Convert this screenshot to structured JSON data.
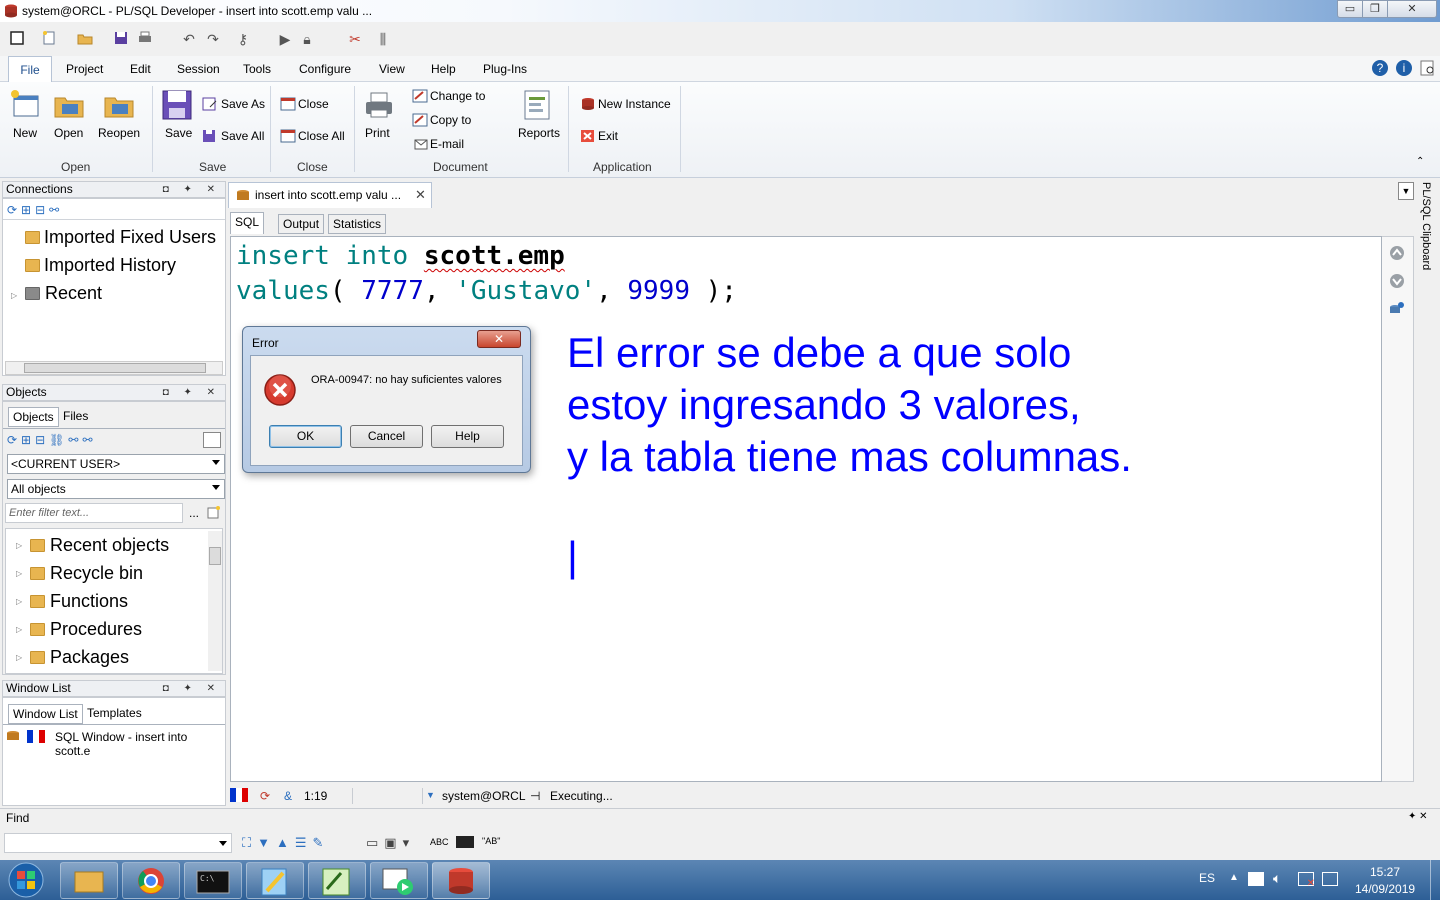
{
  "window": {
    "title": "system@ORCL - PL/SQL Developer - insert into scott.emp valu ...",
    "min_glyph": "▭",
    "max_glyph": "❐",
    "close_glyph": "✕"
  },
  "menu": {
    "tabs": [
      "File",
      "Project",
      "Edit",
      "Session",
      "Tools",
      "Configure",
      "View",
      "Help",
      "Plug-Ins"
    ]
  },
  "ribbon": {
    "open_group": {
      "label": "Open",
      "new": "New",
      "open": "Open",
      "reopen": "Reopen"
    },
    "save_group": {
      "label": "Save",
      "save": "Save",
      "save_as": "Save As",
      "save_all": "Save All"
    },
    "close_group": {
      "label": "Close",
      "close": "Close",
      "close_all": "Close All"
    },
    "document_group": {
      "label": "Document",
      "print": "Print",
      "change_to": "Change to",
      "copy_to": "Copy to",
      "email": "E-mail",
      "reports": "Reports"
    },
    "application_group": {
      "label": "Application",
      "new_instance": "New Instance",
      "exit": "Exit"
    }
  },
  "connections": {
    "title": "Connections",
    "items": [
      "Imported Fixed Users",
      "Imported History",
      "Recent"
    ]
  },
  "objects": {
    "title": "Objects",
    "tabs": [
      "Objects",
      "Files"
    ],
    "user_combo": "<CURRENT USER>",
    "filter_combo": "All objects",
    "filter_placeholder": "Enter filter text...",
    "items": [
      "Recent objects",
      "Recycle bin",
      "Functions",
      "Procedures",
      "Packages"
    ]
  },
  "window_list": {
    "title": "Window List",
    "tabs": [
      "Window List",
      "Templates"
    ],
    "item": "SQL Window - insert into scott.e"
  },
  "editor": {
    "tab_title": "insert into scott.emp valu ...",
    "subtabs": [
      "SQL",
      "Output",
      "Statistics"
    ],
    "code": {
      "kw_insert": "insert",
      "kw_into": "into",
      "table": "scott.emp",
      "kw_values": "values",
      "paren_open": "(",
      "num1": "7777",
      "comma1": ",",
      "str": "'Gustavo'",
      "comma2": ",",
      "num2": "9999",
      "paren_close": ");"
    },
    "annotation": {
      "line1": "El error se debe a que solo",
      "line2": "estoy ingresando 3 valores,",
      "line3": "y la tabla tiene mas columnas.",
      "cursor": "|"
    },
    "side_label": "PL/SQL Clipboard"
  },
  "dialog": {
    "title": "Error",
    "message": "ORA-00947: no hay suficientes valores",
    "ok": "OK",
    "cancel": "Cancel",
    "help": "Help"
  },
  "status": {
    "position": "1:19",
    "connection": "system@ORCL",
    "state": "Executing..."
  },
  "find": {
    "title": "Find",
    "abc": "ABC",
    "ab": "\"AB\""
  },
  "taskbar": {
    "lang": "ES",
    "time": "15:27",
    "date": "14/09/2019"
  },
  "colors": {
    "accent_blue": "#0000ff",
    "code_keyword": "#008080",
    "code_number": "#0000ff",
    "title_gradient_end": "#6f9bd0"
  }
}
